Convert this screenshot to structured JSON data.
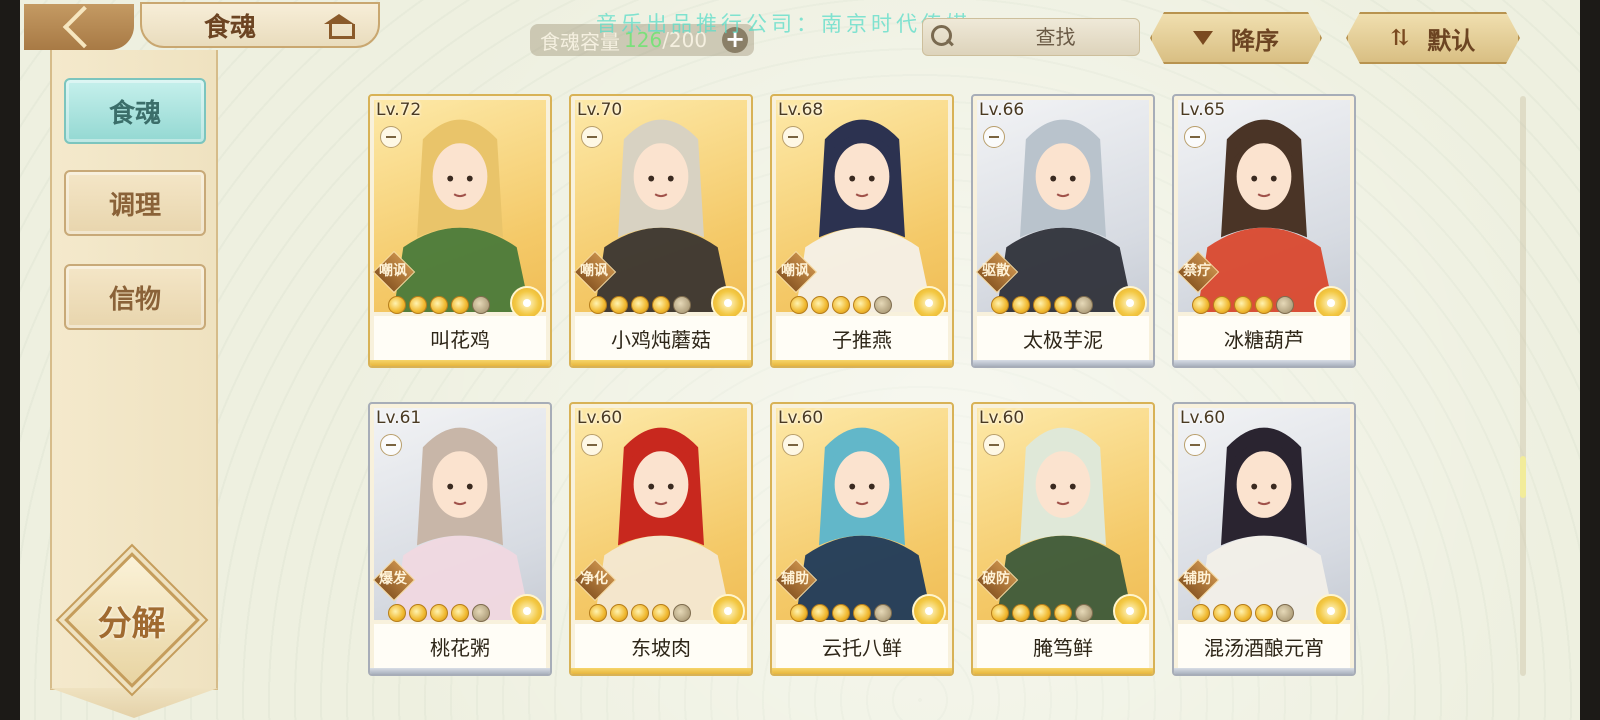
{
  "header": {
    "title": "食魂",
    "watermark": "音乐出品推行公司：南京时代传媒",
    "capacity": {
      "label": "食魂容量",
      "current": "126",
      "max": "/200",
      "add": "+"
    },
    "search": {
      "placeholder": "查找",
      "clear": "✕"
    },
    "sort_order_label": "降序",
    "sort_mode_label": "默认"
  },
  "sidebar": {
    "tabs": [
      {
        "label": "食魂"
      },
      {
        "label": "调理"
      },
      {
        "label": "信物"
      }
    ],
    "decompose_label": "分解"
  },
  "cards": [
    {
      "level": "Lv.72",
      "role": "嘲讽",
      "name": "叫花鸡",
      "frame": "gold",
      "hair": "#e9c46a",
      "coat": "#4a7a3a"
    },
    {
      "level": "Lv.70",
      "role": "嘲讽",
      "name": "小鸡炖蘑菇",
      "frame": "gold",
      "hair": "#d8d2c2",
      "coat": "#3a3530"
    },
    {
      "level": "Lv.68",
      "role": "嘲讽",
      "name": "子推燕",
      "frame": "gold",
      "hair": "#2c3250",
      "coat": "#f4f0e8"
    },
    {
      "level": "Lv.66",
      "role": "驱散",
      "name": "太极芋泥",
      "frame": "silver",
      "hair": "#b9c3cc",
      "coat": "#2f323a"
    },
    {
      "level": "Lv.65",
      "role": "禁疗",
      "name": "冰糖葫芦",
      "frame": "silver",
      "hair": "#4a3426",
      "coat": "#d9482e"
    },
    {
      "level": "Lv.61",
      "role": "爆发",
      "name": "桃花粥",
      "frame": "silver",
      "hair": "#c8b6a8",
      "coat": "#f0d8e0"
    },
    {
      "level": "Lv.60",
      "role": "净化",
      "name": "东坡肉",
      "frame": "gold",
      "hair": "#c8281e",
      "coat": "#f3e8d2"
    },
    {
      "level": "Lv.60",
      "role": "辅助",
      "name": "云托八鲜",
      "frame": "gold",
      "hair": "#62b7c9",
      "coat": "#1f3a5a"
    },
    {
      "level": "Lv.60",
      "role": "破防",
      "name": "腌笃鲜",
      "frame": "gold",
      "hair": "#dfe8d8",
      "coat": "#3d5a3a"
    },
    {
      "level": "Lv.60",
      "role": "辅助",
      "name": "混汤酒酿元宵",
      "frame": "silver",
      "hair": "#2a2430",
      "coat": "#f2efe8"
    }
  ],
  "colors": {
    "accent_teal": "#93d8d2",
    "gold_frame": "#d8b256",
    "silver_frame": "#a7adb8",
    "brown_text": "#6c4422"
  },
  "icons": [
    "back-arrow-icon",
    "pavilion-icon",
    "search-icon",
    "clear-icon",
    "sort-down-icon",
    "swap-icon",
    "flower-icon"
  ]
}
